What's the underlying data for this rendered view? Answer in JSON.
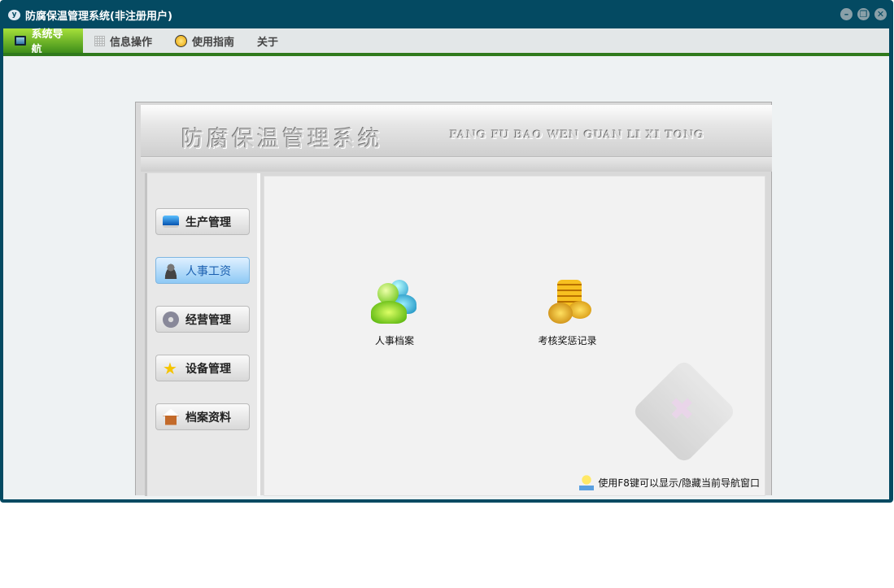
{
  "window": {
    "title": "防腐保温管理系统(非注册用户)",
    "logo_text": "y",
    "controls": [
      "minimize",
      "restore",
      "close"
    ]
  },
  "menu": [
    {
      "label": "系统导航",
      "icon": "monitor-icon",
      "active": true
    },
    {
      "label": "信息操作",
      "icon": "grid-icon"
    },
    {
      "label": "使用指南",
      "icon": "help-icon"
    },
    {
      "label": "关于"
    }
  ],
  "banner": {
    "title": "防腐保温管理系统",
    "subtitle": "FANG FU BAO WEN GUAN LI XI TONG"
  },
  "sidebar": [
    {
      "label": "生产管理",
      "icon": "monitor-icon"
    },
    {
      "label": "人事工资",
      "icon": "person-icon",
      "selected": true
    },
    {
      "label": "经营管理",
      "icon": "gear-icon"
    },
    {
      "label": "设备管理",
      "icon": "star-icon"
    },
    {
      "label": "档案资料",
      "icon": "house-icon"
    }
  ],
  "apps": [
    {
      "label": "人事档案",
      "icon": "users-icon"
    },
    {
      "label": "考核奖惩记录",
      "icon": "coins-icon"
    }
  ],
  "hint": "使用F8键可以显示/隐藏当前导航窗口",
  "colors": {
    "frame": "#044a62",
    "accent_green": "#2f7a1c",
    "selected_blue": "#8ec9f5"
  }
}
